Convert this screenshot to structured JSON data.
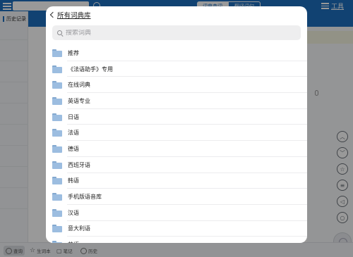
{
  "background": {
    "sidebar": {
      "history_label": "历史记录"
    },
    "header": {
      "tabs": [
        {
          "label": "词典查词"
        },
        {
          "label": "翻译词句"
        }
      ],
      "tools_label": "工具"
    },
    "bottom_bar": {
      "items": [
        {
          "label": "查询",
          "icon": "search-icon"
        },
        {
          "label": "生词本",
          "icon": "star-icon"
        },
        {
          "label": "笔记",
          "icon": "note-icon"
        },
        {
          "label": "历史",
          "icon": "clock-icon"
        }
      ]
    },
    "right_buttons": [
      "chevron-up-icon",
      "chevron-down-icon",
      "star-icon",
      "list-icon",
      "speaker-icon",
      "search-icon"
    ]
  },
  "modal": {
    "title": "所有词典库",
    "search": {
      "placeholder": "搜索词典",
      "value": ""
    },
    "items": [
      {
        "label": "推荐"
      },
      {
        "label": "《法语助手》专用"
      },
      {
        "label": "在线词典"
      },
      {
        "label": "英语专业"
      },
      {
        "label": "日语"
      },
      {
        "label": "法语"
      },
      {
        "label": "德语"
      },
      {
        "label": "西班牙语"
      },
      {
        "label": "韩语"
      },
      {
        "label": "手机版语音库"
      },
      {
        "label": "汉语"
      },
      {
        "label": "意大利语"
      },
      {
        "label": "英语"
      }
    ]
  },
  "colors": {
    "accent": "#1d6fbf",
    "folder": "#9cbde0",
    "overlay": "rgba(0,0,0,0.40)"
  }
}
